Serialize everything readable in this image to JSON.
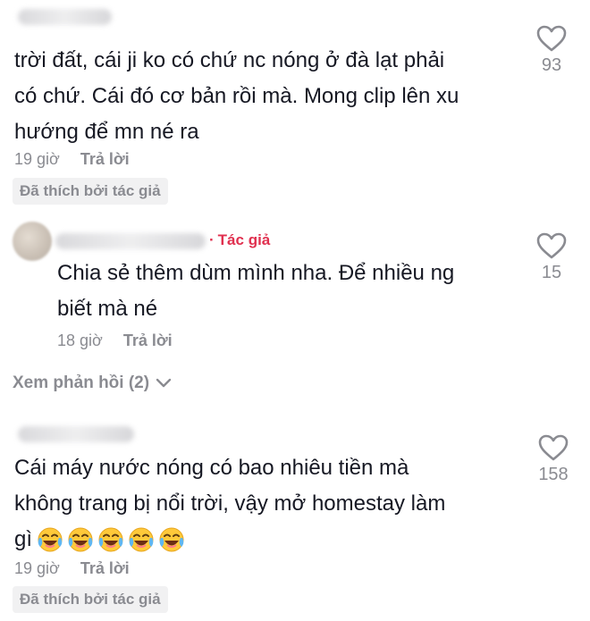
{
  "comments": [
    {
      "text_lines": [
        "trời đất, cái ji ko có chứ nc nóng ở đà lạt phải",
        "có chứ. Cái đó cơ bản rồi mà. Mong clip lên xu",
        "hướng để mn né ra"
      ],
      "time": "19 giờ",
      "reply_label": "Trả lời",
      "liked_by_author": "Đã thích bởi tác giả",
      "likes": "93"
    },
    {
      "author_tag": "Tác giả",
      "text_lines": [
        "Chia sẻ thêm dùm mình nha. Để nhiều ng",
        "biết mà né"
      ],
      "time": "18 giờ",
      "reply_label": "Trả lời",
      "likes": "15"
    },
    {
      "text_lines": [
        "Cái máy nước nóng có bao nhiêu tiền mà",
        "không trang bị nổi trời, vậy mở homestay làm",
        "gì"
      ],
      "emojis": [
        "laughing-tears-emoji",
        "laughing-tears-emoji",
        "laughing-tears-emoji",
        "laughing-tears-emoji",
        "laughing-tears-emoji"
      ],
      "time": "19 giờ",
      "reply_label": "Trả lời",
      "liked_by_author": "Đã thích bởi tác giả",
      "likes": "158"
    }
  ],
  "view_replies": "Xem phản hồi (2)",
  "colors": {
    "author_tag": "#e0304f",
    "secondary_text": "#8a8b91",
    "badge_bg": "#f1f1f2"
  }
}
